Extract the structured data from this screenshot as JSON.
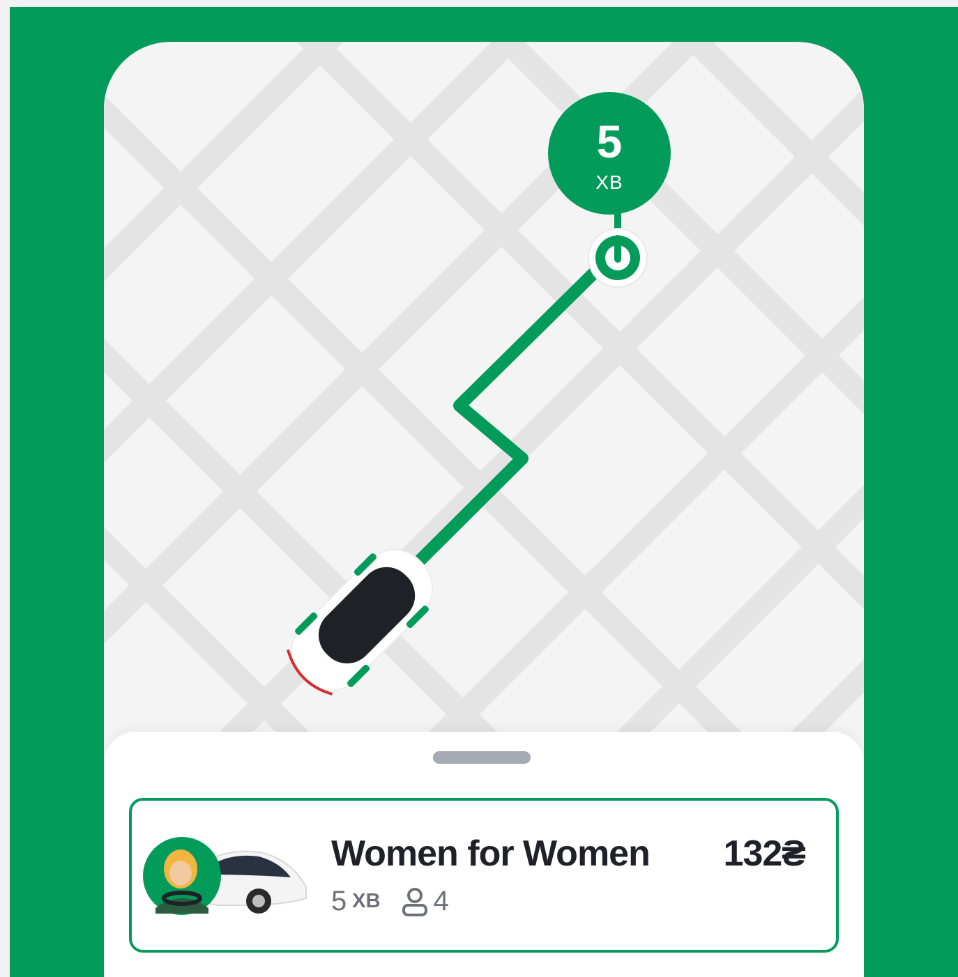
{
  "map": {
    "eta_value": "5",
    "eta_unit": "ХВ",
    "destination_marker_icon": "destination-pin-icon",
    "vehicle_icon": "car-top-view-icon",
    "route_color": "#029b5a"
  },
  "sheet": {
    "handle_icon": "drag-handle-icon"
  },
  "ride_option": {
    "title": "Women for Women",
    "price": "132₴",
    "eta_value": "5",
    "eta_unit": "ХВ",
    "seats": "4",
    "seats_icon": "person-icon",
    "thumbnail_icon": "female-driver-car-icon",
    "selected": true
  },
  "colors": {
    "brand": "#029b5a",
    "map_background": "#f4f4f4",
    "map_roads": "#e6e6e6",
    "text_primary": "#1f2128",
    "text_secondary": "#6e7079"
  }
}
